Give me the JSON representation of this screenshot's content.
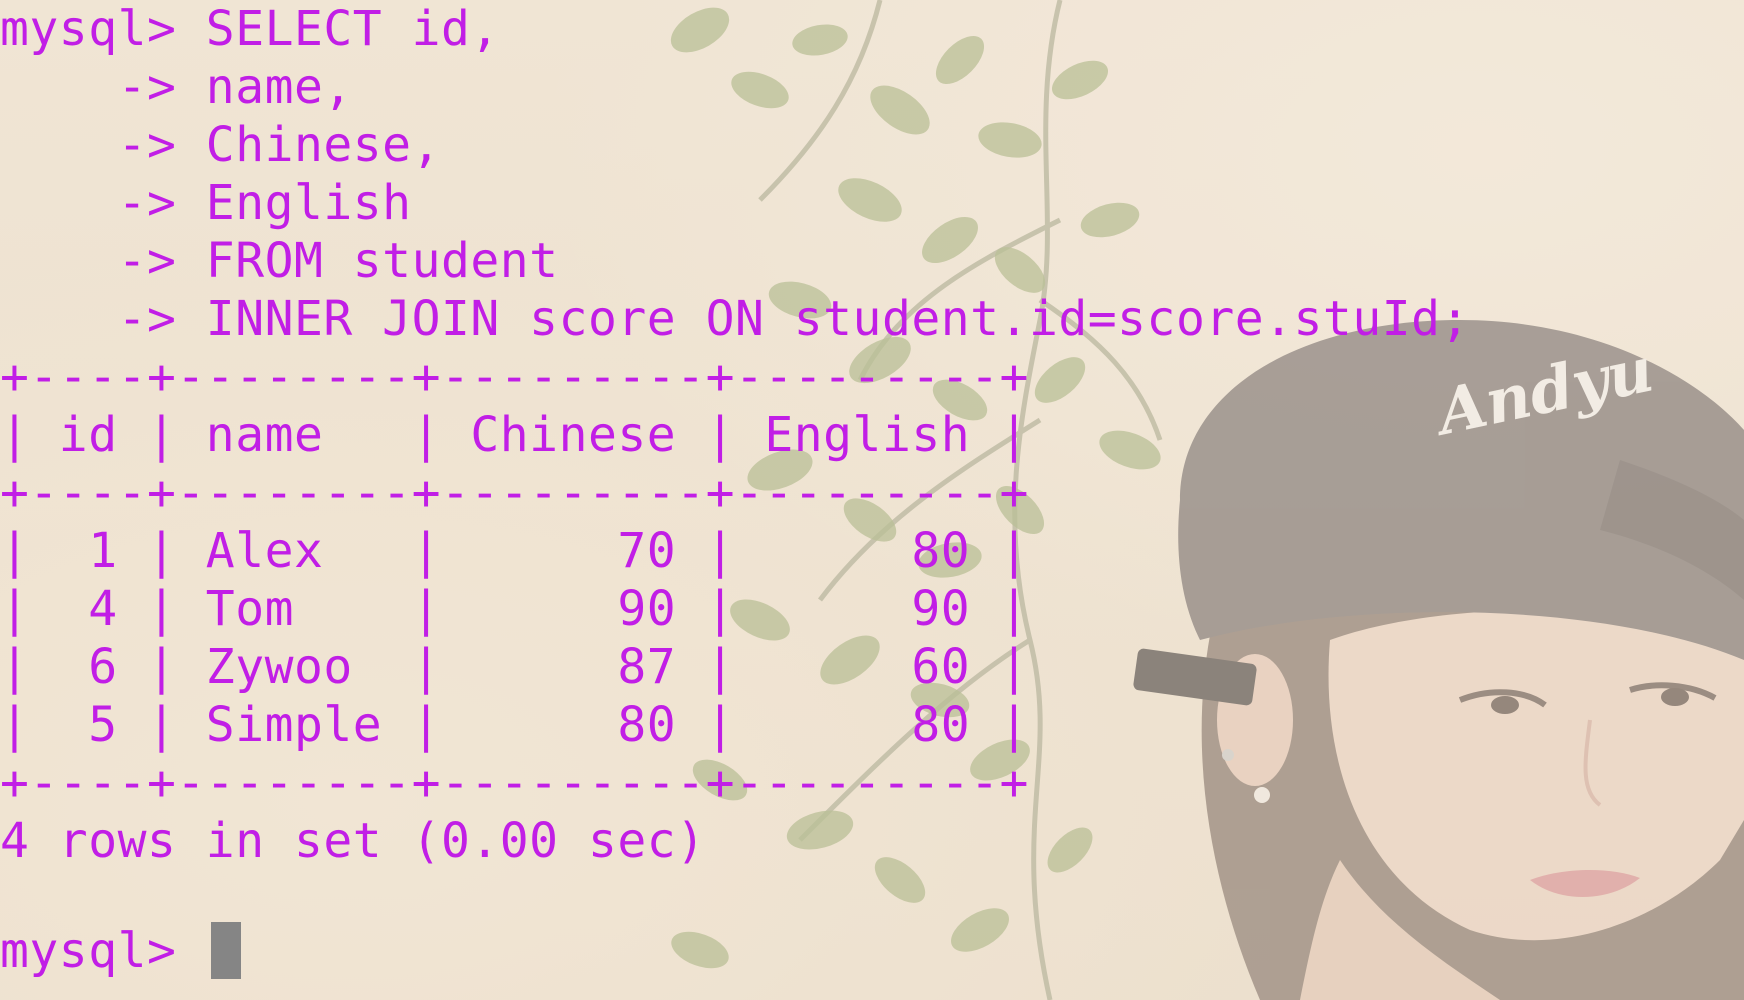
{
  "terminal": {
    "prompt": "mysql> ",
    "query_lines": [
      "mysql> SELECT id,",
      "    -> name,",
      "    -> Chinese,",
      "    -> English",
      "    -> FROM student",
      "    -> INNER JOIN score ON student.id=score.stuId;"
    ],
    "table": {
      "border": "+----+--------+---------+---------+",
      "header": "| id | name   | Chinese | English |",
      "rows": [
        "|  1 | Alex   |      70 |      80 |",
        "|  4 | Tom    |      90 |      90 |",
        "|  6 | Zywoo  |      87 |      60 |",
        "|  5 | Simple |      80 |      80 |"
      ]
    },
    "result_summary": "4 rows in set (0.00 sec)",
    "final_prompt": "mysql> ",
    "text_color": "#c11ee6",
    "cursor_color": "#858585"
  },
  "background": {
    "cap_logo_text": "Andyu"
  }
}
